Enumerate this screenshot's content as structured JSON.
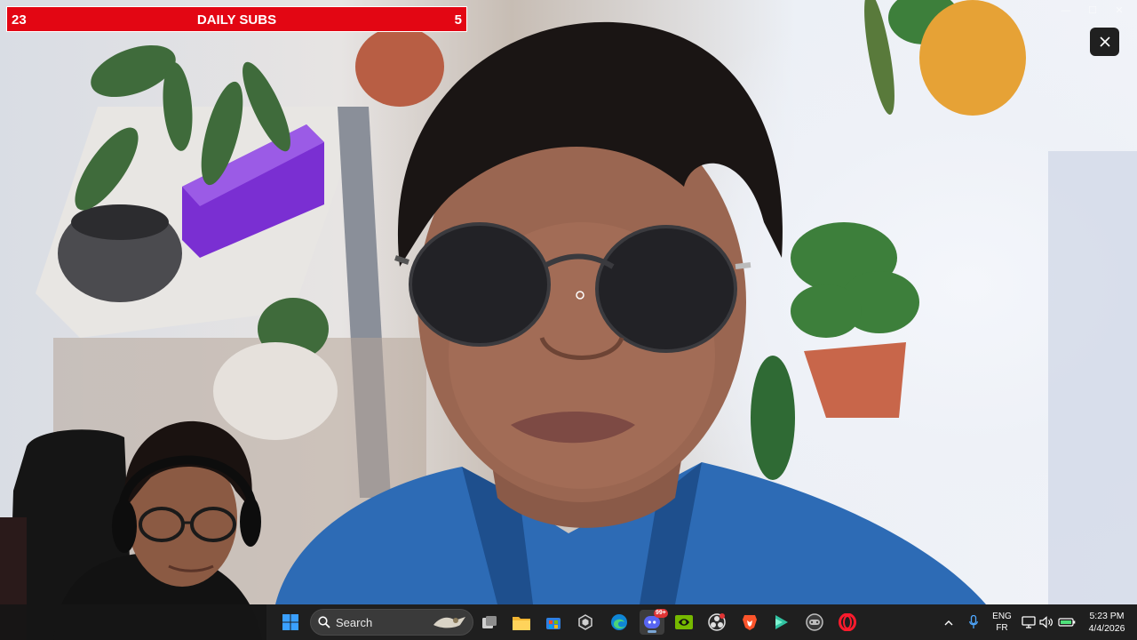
{
  "overlay": {
    "left_count": "23",
    "title": "DAILY SUBS",
    "right_count": "5"
  },
  "taskbar": {
    "search_placeholder": "Search",
    "language_primary": "ENG",
    "language_secondary": "FR",
    "time": "5:23 PM",
    "date": "4/4/2026",
    "discord_badge": "99+"
  },
  "icons": {
    "start": "windows-start-icon",
    "search": "search-icon",
    "task_view": "task-view-icon",
    "file_explorer": "folder-icon",
    "store": "store-icon",
    "app": "hexagon-app-icon",
    "edge": "edge-icon",
    "discord": "discord-icon",
    "nvidia": "nvidia-icon",
    "obs": "obs-icon",
    "brave": "brave-icon",
    "streamlabs": "streamlabs-icon",
    "controller": "controller-icon",
    "opera": "opera-icon",
    "tray_chevron": "chevron-up-icon",
    "mic": "microphone-icon",
    "network": "network-icon",
    "speaker": "speaker-icon",
    "battery": "battery-icon",
    "close": "close-icon"
  },
  "colors": {
    "overlay_red": "#e30613",
    "taskbar_bg": "#202020",
    "opera_red": "#ff1b2d",
    "nvidia_green": "#76b900"
  }
}
